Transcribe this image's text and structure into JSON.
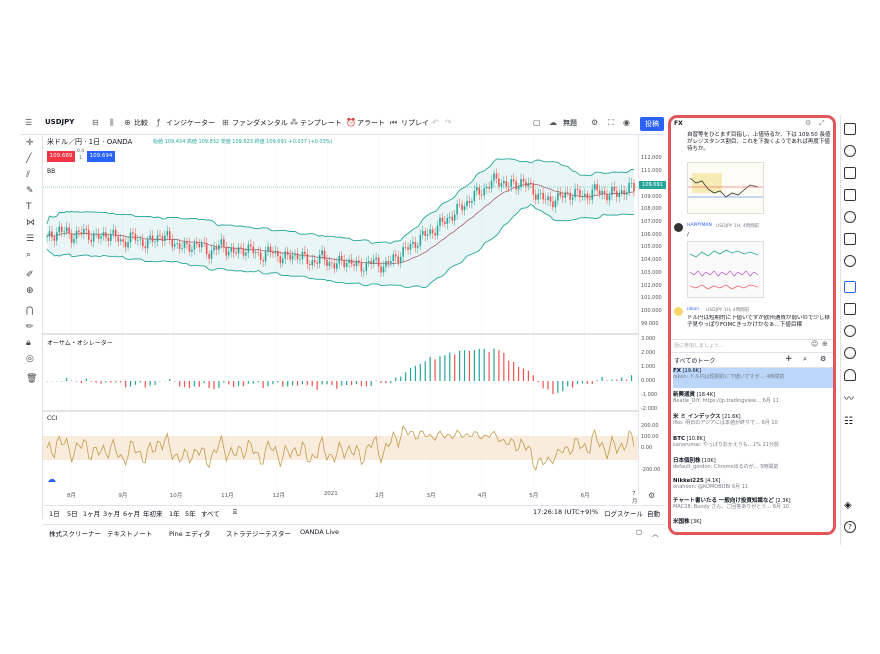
{
  "toolbar": {
    "symbol": "USDJPY",
    "compare": "比較",
    "indicators": "インジケーター",
    "fundamentals": "ファンダメンタル",
    "templates": "テンプレート",
    "alert": "アラート",
    "replay": "リプレイ",
    "unnamed": "無題",
    "publish": "投稿"
  },
  "legend": {
    "title": "米ドル／円 · 1日 · OANDA",
    "ohlc": "始値 109.434 高値 109.832 安値 109.623 終値 109.691 +0.037 (+0.03%)",
    "sell_price": "109.689",
    "buy_price": "109.694",
    "spread_top": "0.4",
    "spread_bottom": "1",
    "bb_label": "BB",
    "ao_label": "オーサム・オシレーター",
    "cci_label": "CCI"
  },
  "price_scale": [
    "112.000",
    "111.000",
    "110.000",
    "109.000",
    "108.000",
    "107.000",
    "106.000",
    "105.000",
    "104.000",
    "103.000",
    "102.000",
    "101.000",
    "100.000",
    "99.000"
  ],
  "current_price": "109.691",
  "ao_scale": [
    "3.000",
    "2.000",
    "1.000",
    "0.000",
    "-1.000",
    "-2.000"
  ],
  "cci_scale": [
    "200.00",
    "100.00",
    "0.00",
    "-200.00"
  ],
  "time_axis": [
    "8月",
    "9月",
    "10月",
    "11月",
    "12月",
    "2021",
    "2月",
    "3月",
    "4月",
    "5月",
    "6月",
    "7月"
  ],
  "ranges": [
    "1日",
    "5日",
    "1ヶ月",
    "3ヶ月",
    "6ヶ月",
    "年初来",
    "1年",
    "5年",
    "すべて"
  ],
  "bottom_right": {
    "clock": "17:26:18 (UTC+9)",
    "pct": "%",
    "log": "ログスケール",
    "auto": "自動"
  },
  "footer_tabs": [
    "株式スクリーナー",
    "テキストノート",
    "Pine エディタ",
    "ストラテジーテスター",
    "OANDA Live"
  ],
  "chat": {
    "header": "FX",
    "msg1": "自習等をひとまず目指し、上値待るか、下は 109.50 長値がレジスタンス割目、これを下抜くようであれば再度下値待ちか。",
    "user2": "HAPPYMAN",
    "user2_meta": "USDJPY 1H, 4時間前",
    "user2_msg": "/",
    "user3": "nikon",
    "user3_meta": "USDJPY 1H, 4時間前",
    "msg3": "ドル円は短期的に下値いですが欧州通貨が弱いので少し様子見やっぱりFOMCきっかけかなぁ…下値目標",
    "input_placeholder": "話に参加しましょう…",
    "all_talks": "すべてのトーク",
    "rooms": [
      {
        "name": "FX",
        "count": "[19.6K]",
        "preview": "nikon: ドル円は短期的に下値いですが…",
        "time": "4時間前"
      },
      {
        "name": "新興通貨",
        "count": "[18.4K]",
        "preview": "Beatle_DIY: https://jp.tradingview…",
        "time": "6月 11"
      },
      {
        "name": "米 ミ インデックス",
        "count": "[21.6K]",
        "preview": "ifko: 明日のアジアには本値が終りで…",
        "time": "6月 10"
      },
      {
        "name": "BTC",
        "count": "[10.8K]",
        "preview": "kanarumai: やっぱりおかえりも…1%",
        "time": "21分前"
      },
      {
        "name": "日本個別株",
        "count": "[10K]",
        "preview": "default_gordon: Chrome出るのが…",
        "time": "5時間前"
      },
      {
        "name": "Nikkei225",
        "count": "[4.1K]",
        "preview": "onahoon: @KOMOBOBI",
        "time": "6月 11"
      },
      {
        "name": "チャート書いたる 一般向け投資知識など",
        "count": "[2.3K]",
        "preview": "MAC28: Bundy さん、ご回答ありがとう…",
        "time": "6月 10"
      },
      {
        "name": "米国株",
        "count": "[3K]",
        "preview": "",
        "time": ""
      }
    ]
  },
  "colors": {
    "accent": "#2962ff",
    "sell": "#f23645",
    "buy": "#2962ff",
    "highlight": "#e15759",
    "band": "#26a69a"
  },
  "chart_data": {
    "type": "candlestick",
    "x_ticks": [
      "8月",
      "9月",
      "10月",
      "11月",
      "12月",
      "2021",
      "2月",
      "3月",
      "4月",
      "5月",
      "6月",
      "7月"
    ],
    "close": [
      105.6,
      106.4,
      105.9,
      106.2,
      105.7,
      106.1,
      105.4,
      105.8,
      105.2,
      106.0,
      105.5,
      104.9,
      105.3,
      104.6,
      105.2,
      104.5,
      105.0,
      104.3,
      104.7,
      104.1,
      104.5,
      103.8,
      104.2,
      103.6,
      104.0,
      103.4,
      103.9,
      103.5,
      104.3,
      105.0,
      105.8,
      106.4,
      107.2,
      108.0,
      108.9,
      109.6,
      110.4,
      109.8,
      110.2,
      109.4,
      108.6,
      108.9,
      109.3,
      109.0,
      109.5,
      109.1,
      109.4,
      109.7
    ],
    "ylim": [
      98.5,
      112.5
    ]
  }
}
